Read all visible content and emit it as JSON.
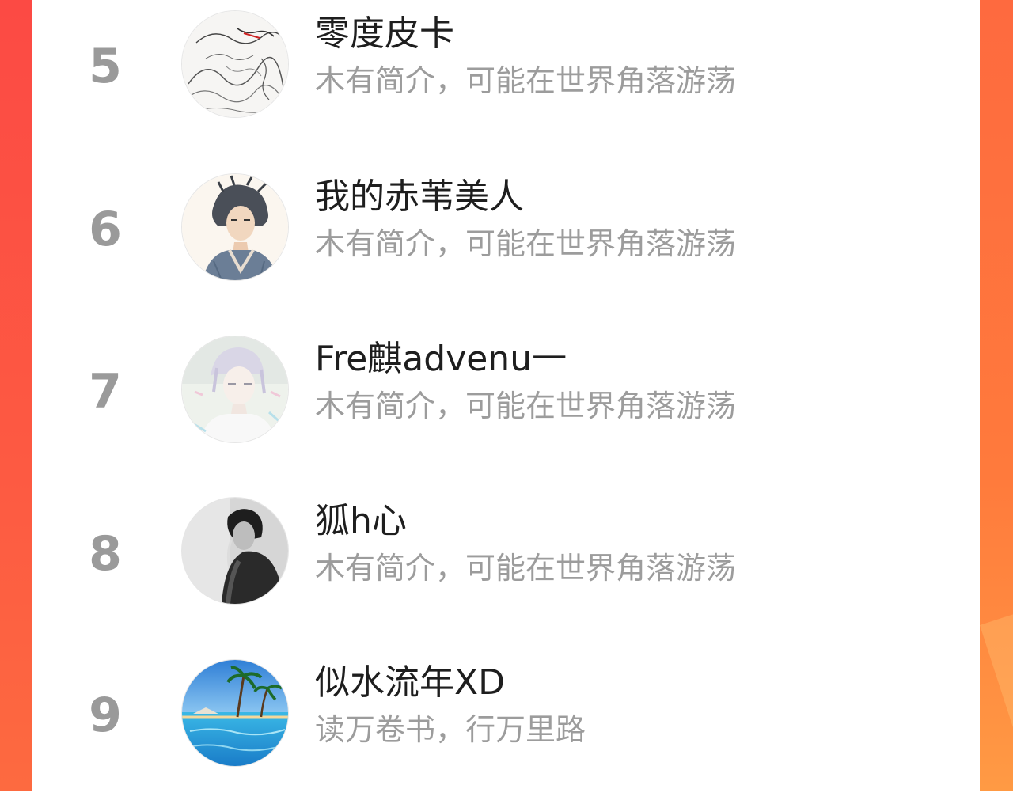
{
  "ranking": {
    "items": [
      {
        "rank": "5",
        "name": "零度皮卡",
        "bio": "木有简介，可能在世界角落游荡",
        "avatar": "ink-sketch-avatar"
      },
      {
        "rank": "6",
        "name": "我的赤苇美人",
        "bio": "木有简介，可能在世界角落游荡",
        "avatar": "anime-boy-avatar"
      },
      {
        "rank": "7",
        "name": "Fre麒advenu一",
        "bio": "木有简介，可能在世界角落游荡",
        "avatar": "pastel-anime-avatar"
      },
      {
        "rank": "8",
        "name": "狐h心",
        "bio": "木有简介，可能在世界角落游荡",
        "avatar": "bw-portrait-avatar"
      },
      {
        "rank": "9",
        "name": "似水流年XD",
        "bio": "读万卷书，行万里路",
        "avatar": "beach-palm-avatar"
      }
    ]
  },
  "colors": {
    "frame_left": "#fc4a44",
    "frame_right": "#ff7a3c",
    "rank_text": "#9a9a9a",
    "name_text": "#1e1e1e",
    "bio_text": "#9c9c9c"
  }
}
